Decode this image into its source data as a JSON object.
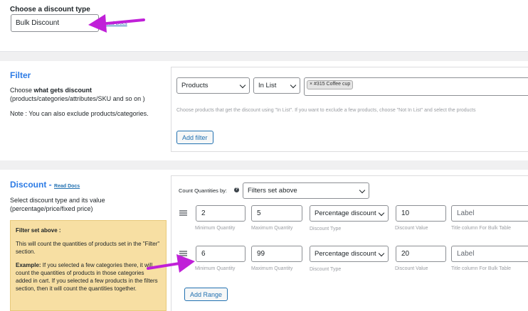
{
  "discount_type": {
    "label": "Choose a discount type",
    "value": "Bulk Discount",
    "read_docs": "Read Docs"
  },
  "filter": {
    "title": "Filter",
    "desc_prefix": "Choose ",
    "desc_bold": "what gets discount",
    "desc_rest": "(products/categories/attributes/SKU and so on )",
    "note": "Note : You can also exclude products/categories.",
    "type_select": "Products",
    "method_select": "In List",
    "token": "× #315 Coffee cup",
    "hint": "Choose products that get the discount using \"In List\". If you want to exclude a few products, choose \"Not In List\" and select the products",
    "add_filter": "Add filter"
  },
  "discount": {
    "title": "Discount -",
    "read_docs": "Read Docs",
    "desc": "Select discount type and its value (percentage/price/fixed price)",
    "count_label": "Count Quantities by:",
    "count_select": "Filters set above",
    "callout": {
      "heading": "Filter set above :",
      "body": "This will count the quantities of products set in the \"Filter\" section.",
      "example_label": "Example:",
      "example_text": " If you selected a few categories there, it will count the quantities of products in those categories added in cart. If you selected a few products in the filters section, then it will count the quantities together."
    },
    "labels": {
      "min": "Minimum Quantity",
      "max": "Maximum Quantity",
      "type": "Discount Type",
      "value": "Discount Value",
      "title_col": "Title column For Bulk Table"
    },
    "ranges": [
      {
        "min": "2",
        "max": "5",
        "type": "Percentage discount",
        "value": "10",
        "label_placeholder": "Label"
      },
      {
        "min": "6",
        "max": "99",
        "type": "Percentage discount",
        "value": "20",
        "label_placeholder": "Label"
      }
    ],
    "add_range": "Add Range"
  },
  "colors": {
    "arrow": "#c020d8",
    "accent": "#2271b1",
    "callout": "#f7dfa3"
  }
}
